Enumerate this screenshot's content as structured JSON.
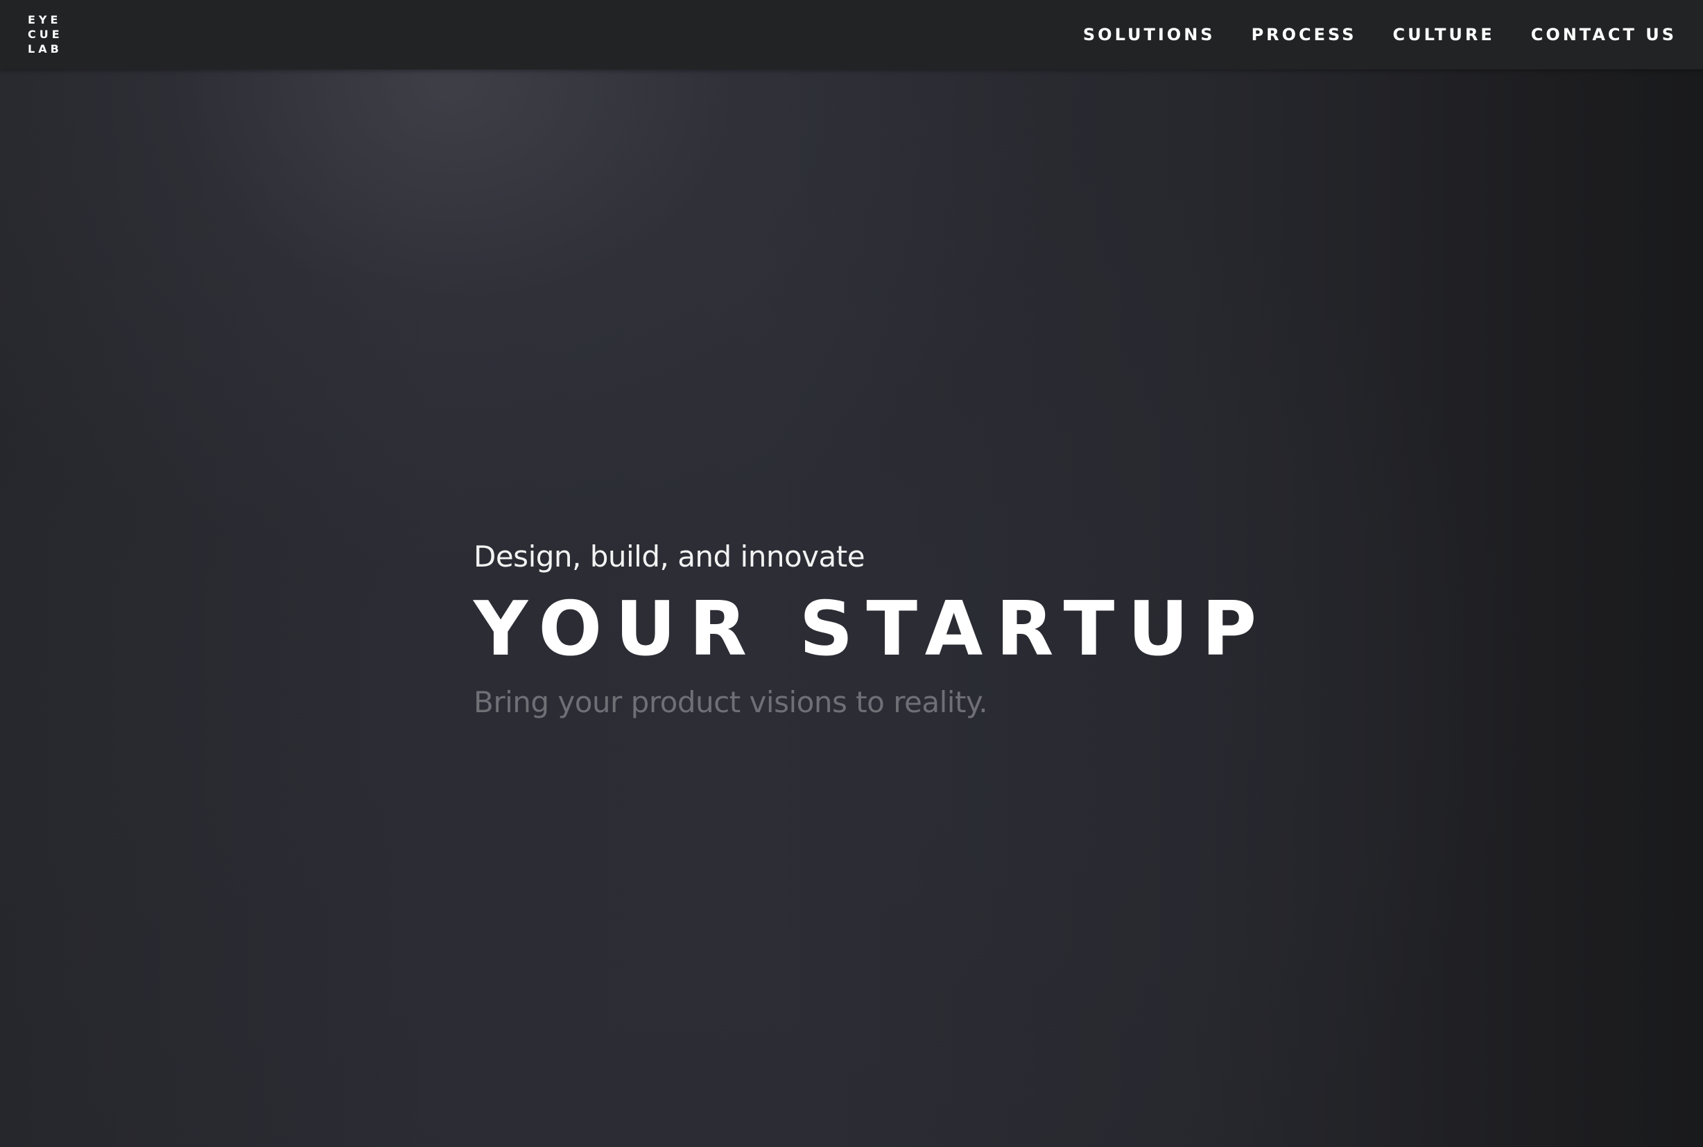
{
  "navbar": {
    "logo_lines": [
      "EYE",
      "CUE",
      "LAB"
    ],
    "links": [
      {
        "label": "SOLUTIONS",
        "icon": ""
      },
      {
        "label": "PROCESS",
        "icon": ""
      },
      {
        "label": "CULTURE",
        "icon": ""
      },
      {
        "label": "CONTACT US",
        "icon": ""
      }
    ]
  },
  "hero": {
    "tagline": "Design, build, and innovate",
    "headline": "YOUR STARTUP",
    "subtitle": "Bring your product visions to reality."
  },
  "colors": {
    "navbar_bg": "#222324",
    "hero_bg": "#2b2c33",
    "text_primary": "#ffffff",
    "text_muted": "#6f7076"
  }
}
